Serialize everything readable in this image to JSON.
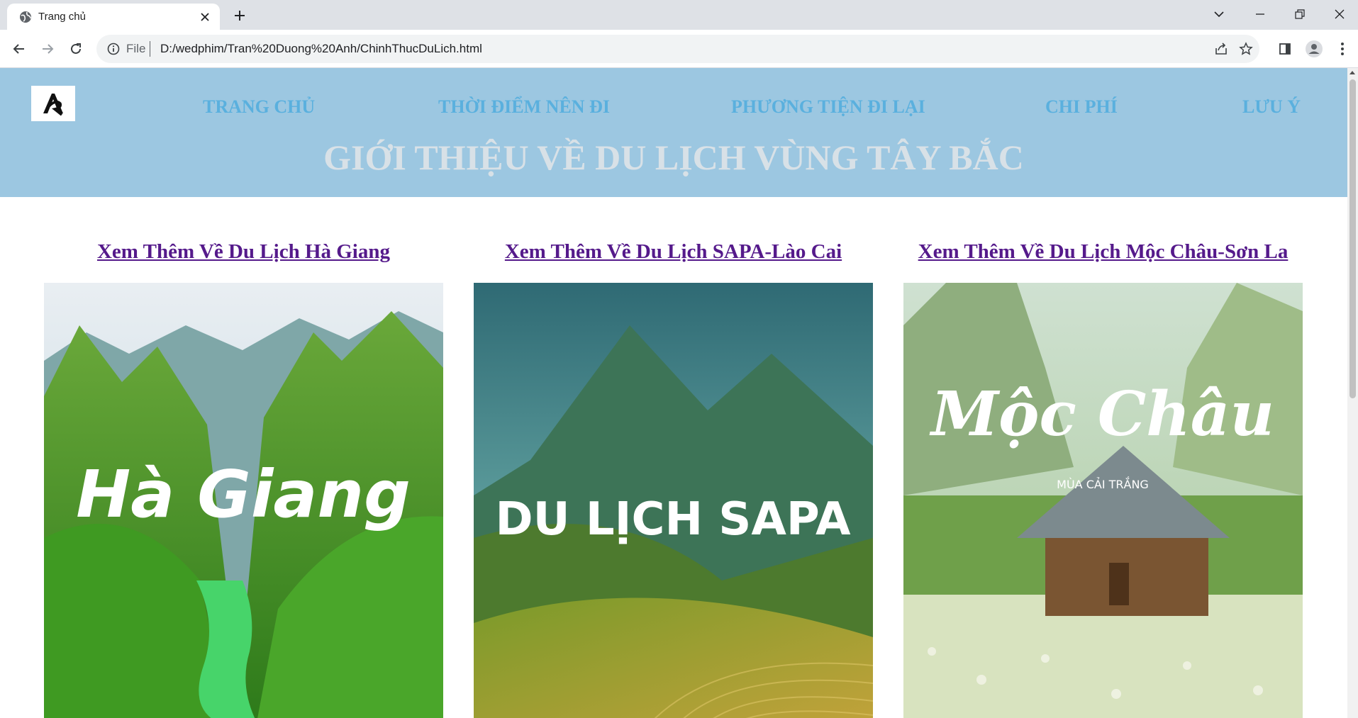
{
  "browser": {
    "tab_title": "Trang chủ",
    "omnibox_scheme": "File",
    "url": "D:/wedphim/Tran%20Duong%20Anh/ChinhThucDuLich.html"
  },
  "site": {
    "nav": [
      "TRANG CHỦ",
      "THỜI ĐIỂM NÊN ĐI",
      "PHƯƠNG TIỆN ĐI LẠI",
      "CHI PHÍ",
      "LƯU Ý"
    ],
    "title": "GIỚI THIỆU VỀ DU LỊCH VÙNG TÂY BẮC",
    "cards": [
      {
        "link": "Xem Thêm Về Du Lịch Hà Giang",
        "image_text": "Hà Giang"
      },
      {
        "link": "Xem Thêm Về Du Lịch SAPA-Lào Cai",
        "image_text": "DU LỊCH SAPA"
      },
      {
        "link": "Xem Thêm Về Du Lịch Mộc Châu-Sơn La",
        "image_text": "Mộc Châu",
        "image_subtext": "MÙA CẢI TRẮNG"
      }
    ]
  },
  "colors": {
    "header_bg": "#9cc7e1",
    "nav_link": "#5ab0de",
    "title_text": "#d8e1e7",
    "visited_link": "#551a8b",
    "chrome_tabbar": "#dee1e6",
    "omnibox_bg": "#f1f3f4"
  },
  "icons": {
    "tab_favicon": "globe-icon",
    "tab_close": "close-icon",
    "new_tab": "plus-icon",
    "back": "arrow-left-icon",
    "forward": "arrow-right-icon",
    "reload": "reload-icon",
    "site_info": "info-icon",
    "share": "share-icon",
    "bookmark": "star-icon",
    "side_panel": "side-panel-icon",
    "profile": "profile-icon",
    "menu": "kebab-menu-icon"
  }
}
